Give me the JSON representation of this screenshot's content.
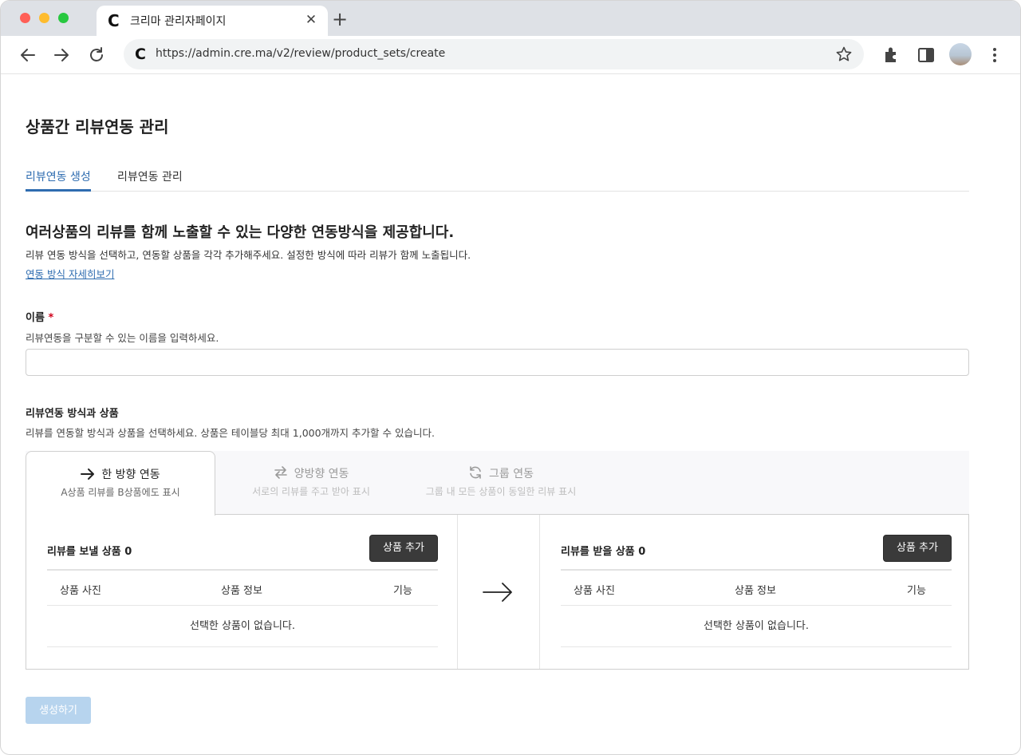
{
  "browser": {
    "tab_title": "크리마 관리자페이지",
    "favicon_letter": "C",
    "url": "https://admin.cre.ma/v2/review/product_sets/create",
    "icons": [
      "back-arrow-icon",
      "forward-arrow-icon",
      "reload-icon",
      "star-icon",
      "extensions-icon",
      "side-panel-icon",
      "kebab-menu-icon"
    ]
  },
  "page": {
    "title": "상품간 리뷰연동 관리",
    "tabs": [
      {
        "label": "리뷰연동 생성",
        "active": true
      },
      {
        "label": "리뷰연동 관리",
        "active": false
      }
    ],
    "intro": {
      "heading": "여러상품의 리뷰를 함께 노출할 수 있는 다양한 연동방식을 제공합니다.",
      "description": "리뷰 연동 방식을 선택하고, 연동할 상품을 각각 추가해주세요. 설정한 방식에 따라 리뷰가 함께 노출됩니다.",
      "link": "연동 방식 자세히보기"
    },
    "name_field": {
      "label": "이름",
      "required_mark": "*",
      "help": "리뷰연동을 구분할 수 있는 이름을 입력하세요.",
      "value": "",
      "placeholder": ""
    },
    "method_section": {
      "label": "리뷰연동 방식과 상품",
      "help": "리뷰를 연동할 방식과 상품을 선택하세요. 상품은 테이블당 최대 1,000개까지 추가할 수 있습니다.",
      "methods": [
        {
          "title": "한 방향 연동",
          "subtitle": "A상품 리뷰를 B상품에도 표시",
          "icon": "arrow-right-icon",
          "active": true
        },
        {
          "title": "양방향 연동",
          "subtitle": "서로의 리뷰를 주고 받아 표시",
          "icon": "swap-arrows-icon",
          "active": false
        },
        {
          "title": "그룹 연동",
          "subtitle": "그룹 내 모든 상품이 동일한 리뷰 표시",
          "icon": "refresh-icon",
          "active": false
        }
      ]
    },
    "sender": {
      "title": "리뷰를 보낼 상품 0",
      "add_button": "상품 추가",
      "columns": [
        "상품 사진",
        "상품 정보",
        "기능"
      ],
      "empty": "선택한 상품이 없습니다."
    },
    "receiver": {
      "title": "리뷰를 받을 상품 0",
      "add_button": "상품 추가",
      "columns": [
        "상품 사진",
        "상품 정보",
        "기능"
      ],
      "empty": "선택한 상품이 없습니다."
    },
    "submit_button": "생성하기",
    "colors": {
      "accent": "#2e6cb0",
      "button_dark": "#3a3a3a",
      "submit_disabled": "#b7d4ee",
      "required": "#d0021b"
    }
  }
}
